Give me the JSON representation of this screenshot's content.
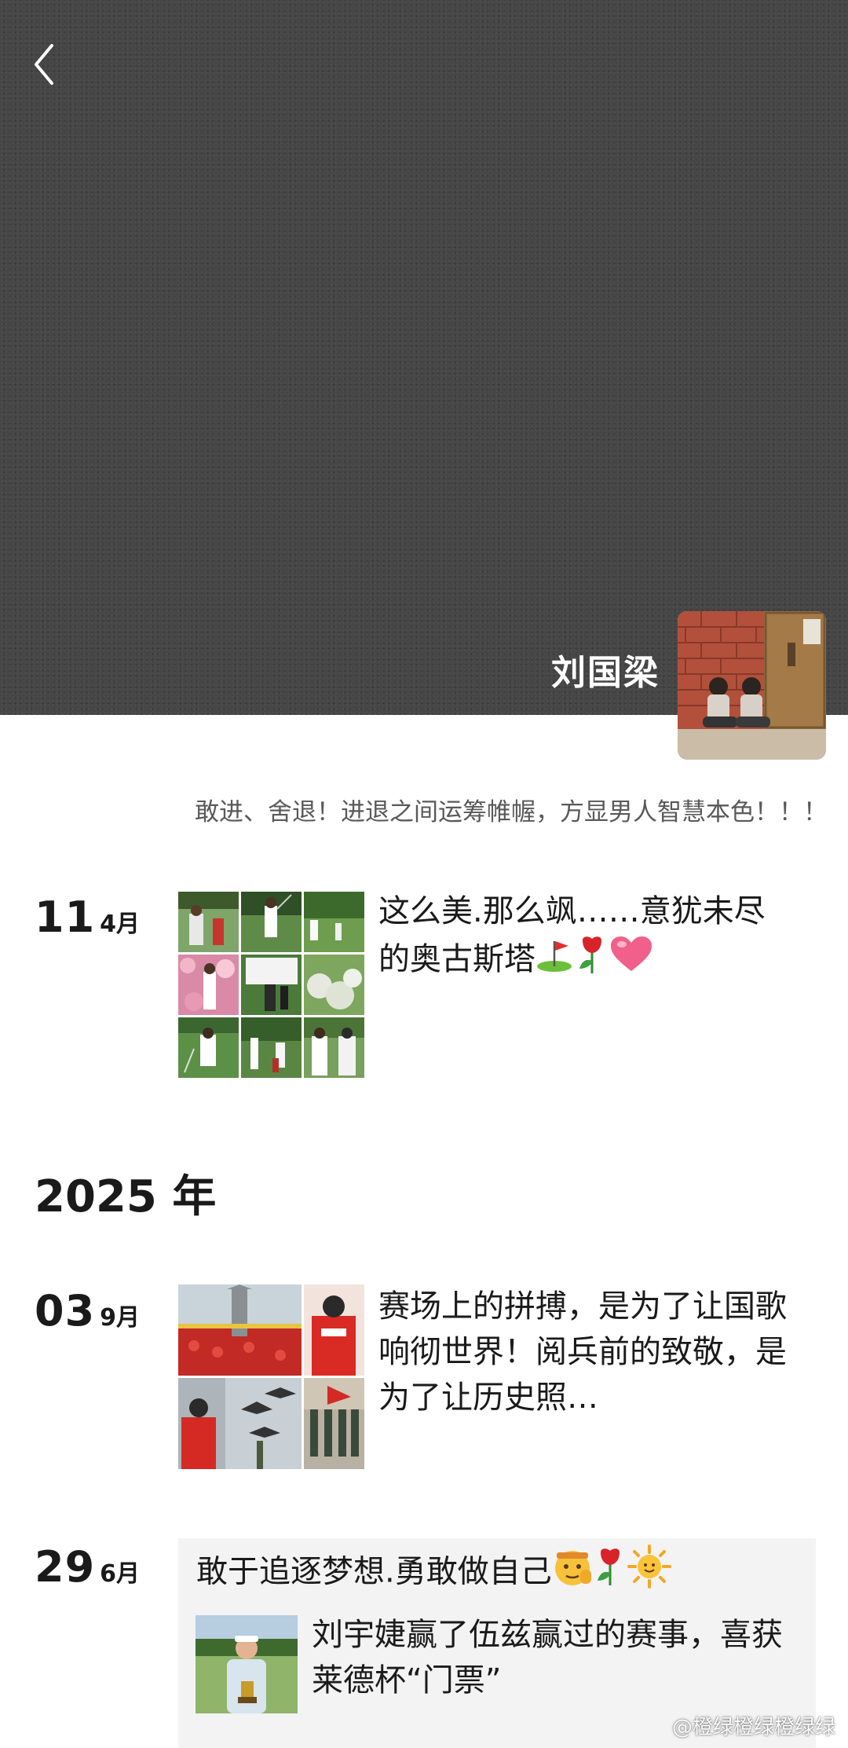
{
  "profile": {
    "name": "刘国梁",
    "signature": "敢进、舍退！进退之间运筹帷幄，方显男人智慧本色！！！"
  },
  "posts": [
    {
      "day": "11",
      "month": "4月",
      "text": "这么美.那么飒……意犹未尽的奥古斯塔",
      "emojis": [
        "golf-flag",
        "rose",
        "heart"
      ]
    },
    {
      "day": "03",
      "month": "9月",
      "text": "赛场上的拼搏，是为了让国歌响彻世界！阅兵前的致敬，是为了让历史照…"
    },
    {
      "day": "29",
      "month": "6月",
      "shared_title": "敢于追逐梦想.勇敢做自己",
      "emojis": [
        "saluting-face",
        "rose",
        "sun"
      ],
      "shared_text": "刘宇婕赢了伍兹赢过的赛事，喜获莱德杯“门票”"
    }
  ],
  "year_header": "2025 年",
  "watermark": "@橙绿橙绿橙绿绿"
}
